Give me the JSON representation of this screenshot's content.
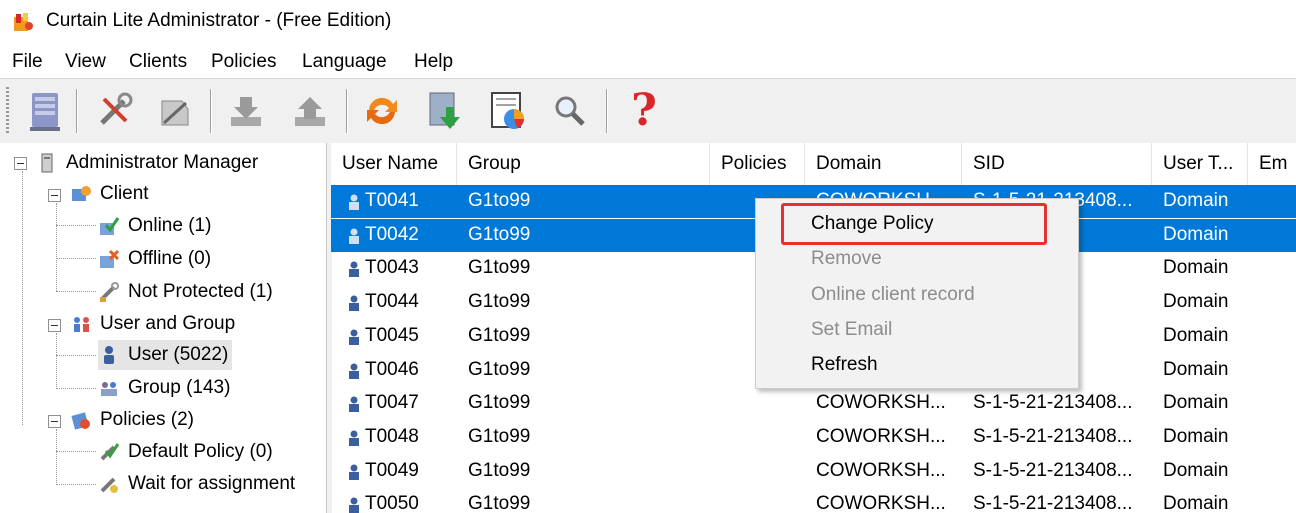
{
  "window": {
    "title": "Curtain Lite Administrator - (Free Edition)"
  },
  "menu": [
    "File",
    "View",
    "Clients",
    "Policies",
    "Language",
    "Help"
  ],
  "toolbar": {
    "buttons": [
      "server-icon",
      "settings-tools-icon",
      "policy-tools-icon",
      "download-icon",
      "upload-icon",
      "refresh-icon",
      "import-icon",
      "report-chart-icon",
      "search-icon",
      "help-icon"
    ]
  },
  "tree": {
    "root": "Administrator Manager",
    "client": "Client",
    "online": "Online (1)",
    "offline": "Offline (0)",
    "not_protected": "Not Protected (1)",
    "user_group": "User and Group",
    "user": "User (5022)",
    "group": "Group (143)",
    "policies": "Policies (2)",
    "default_policy": "Default Policy (0)",
    "wait_assignment": "Wait for assignment"
  },
  "list": {
    "columns": [
      "User Name",
      "Group",
      "Policies",
      "Domain",
      "SID",
      "User T...",
      "Em"
    ],
    "rows": [
      {
        "user": "T0041",
        "group": "G1to99",
        "policies": "",
        "domain": "COWORKSH...",
        "sid": "S-1-5-21-213408...",
        "type": "Domain"
      },
      {
        "user": "T0042",
        "group": "G1to99",
        "policies": "",
        "domain": "",
        "sid": "3408...",
        "type": "Domain"
      },
      {
        "user": "T0043",
        "group": "G1to99",
        "policies": "",
        "domain": "",
        "sid": "3408...",
        "type": "Domain"
      },
      {
        "user": "T0044",
        "group": "G1to99",
        "policies": "",
        "domain": "",
        "sid": "3408...",
        "type": "Domain"
      },
      {
        "user": "T0045",
        "group": "G1to99",
        "policies": "",
        "domain": "",
        "sid": "3408...",
        "type": "Domain"
      },
      {
        "user": "T0046",
        "group": "G1to99",
        "policies": "",
        "domain": "",
        "sid": "3408...",
        "type": "Domain"
      },
      {
        "user": "T0047",
        "group": "G1to99",
        "policies": "",
        "domain": "COWORKSH...",
        "sid": "S-1-5-21-213408...",
        "type": "Domain"
      },
      {
        "user": "T0048",
        "group": "G1to99",
        "policies": "",
        "domain": "COWORKSH...",
        "sid": "S-1-5-21-213408...",
        "type": "Domain"
      },
      {
        "user": "T0049",
        "group": "G1to99",
        "policies": "",
        "domain": "COWORKSH...",
        "sid": "S-1-5-21-213408...",
        "type": "Domain"
      },
      {
        "user": "T0050",
        "group": "G1to99",
        "policies": "",
        "domain": "COWORKSH...",
        "sid": "S-1-5-21-213408...",
        "type": "Domain"
      }
    ]
  },
  "context_menu": {
    "change_policy": "Change Policy",
    "remove": "Remove",
    "online_record": "Online client record",
    "set_email": "Set Email",
    "refresh": "Refresh"
  },
  "colors": {
    "selection": "#0078d7",
    "highlight": "#e8312f"
  }
}
